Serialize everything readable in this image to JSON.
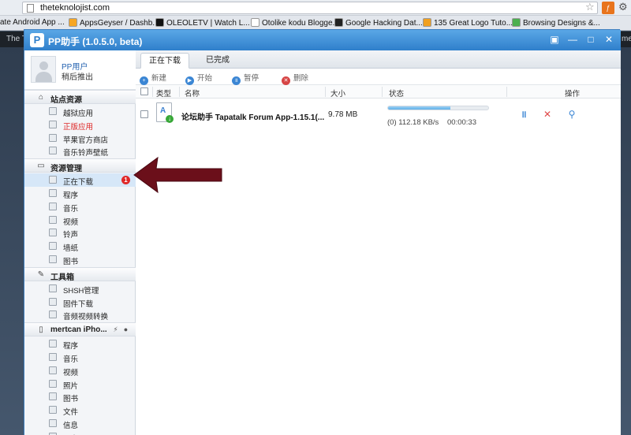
{
  "browser": {
    "url": "theteknolojist.com",
    "bookmarks": [
      {
        "label": "ate Android App ...",
        "color": "#8bc34a"
      },
      {
        "label": "AppsGeyser / Dashb...",
        "color": "#f6a623"
      },
      {
        "label": "OLEOLETV | Watch L...",
        "color": "#111111"
      },
      {
        "label": "Otolike kodu Blogge...",
        "color": "#ffffff"
      },
      {
        "label": "Google Hacking Dat...",
        "color": "#222222"
      },
      {
        "label": "135 Great Logo Tuto...",
        "color": "#f0a020"
      },
      {
        "label": "Browsing Designs &...",
        "color": "#4caf50"
      }
    ],
    "ext_label": "ƒ",
    "site_left": "The T",
    "site_right": "me"
  },
  "app": {
    "title": "PP助手 (1.0.5.0, beta)",
    "logo": "P",
    "window_buttons": [
      "▣",
      "—",
      "□",
      "✕"
    ],
    "user": {
      "name": "PP用户",
      "action": "稍后推出"
    },
    "groups": [
      {
        "label": "站点资源",
        "icon": "house-icon",
        "items": [
          {
            "label": "越狱应用",
            "icon": "jailbreak-icon",
            "state": "normal"
          },
          {
            "label": "正版应用",
            "icon": "store-icon",
            "state": "red"
          },
          {
            "label": "苹果官方商店",
            "icon": "apple-store-icon",
            "state": "normal"
          },
          {
            "label": "音乐铃声壁纸",
            "icon": "music-wallpaper-icon",
            "state": "normal"
          }
        ]
      },
      {
        "label": "资源管理",
        "icon": "monitor-icon",
        "items": [
          {
            "label": "正在下载",
            "icon": "download-icon",
            "state": "active",
            "badge": "1"
          },
          {
            "label": "程序",
            "icon": "program-icon",
            "state": "normal"
          },
          {
            "label": "音乐",
            "icon": "music-icon",
            "state": "normal"
          },
          {
            "label": "视频",
            "icon": "video-icon",
            "state": "normal"
          },
          {
            "label": "铃声",
            "icon": "ringtone-icon",
            "state": "normal"
          },
          {
            "label": "墙纸",
            "icon": "wallpaper-icon",
            "state": "normal"
          },
          {
            "label": "图书",
            "icon": "book-icon",
            "state": "normal"
          }
        ]
      },
      {
        "label": "工具箱",
        "icon": "toolbox-icon",
        "items": [
          {
            "label": "SHSH管理",
            "icon": "shsh-icon",
            "state": "normal"
          },
          {
            "label": "固件下载",
            "icon": "firmware-icon",
            "state": "normal"
          },
          {
            "label": "音频视频转换",
            "icon": "convert-icon",
            "state": "normal"
          }
        ]
      },
      {
        "label": "mertcan iPho...",
        "icon": "iphone-icon",
        "right_icons": [
          "charging-icon",
          "info-icon"
        ],
        "items": [
          {
            "label": "程序",
            "icon": "program-icon",
            "state": "normal"
          },
          {
            "label": "音乐",
            "icon": "music-icon",
            "state": "normal"
          },
          {
            "label": "视频",
            "icon": "video-icon",
            "state": "normal"
          },
          {
            "label": "照片",
            "icon": "photo-icon",
            "state": "normal"
          },
          {
            "label": "图书",
            "icon": "book-icon",
            "state": "normal"
          },
          {
            "label": "文件",
            "icon": "file-icon",
            "state": "normal"
          },
          {
            "label": "信息",
            "icon": "message-icon",
            "state": "normal"
          },
          {
            "label": "更多",
            "icon": "more-icon",
            "state": "normal"
          }
        ]
      }
    ],
    "tabs": [
      {
        "label": "正在下载",
        "active": true
      },
      {
        "label": "已完成",
        "active": false
      }
    ],
    "toolbar": {
      "new": "新建",
      "start": "开始",
      "pause": "暂停",
      "delete": "删除"
    },
    "columns": {
      "type": "类型",
      "name": "名称",
      "size": "大小",
      "status": "状态",
      "ops": "操作"
    },
    "downloads": [
      {
        "name": "论坛助手 Tapatalk Forum App-1.15.1(...",
        "size": "9.78 MB",
        "progress": 0.62,
        "speed": "(0) 112.18 KB/s",
        "time": "00:00:33"
      }
    ],
    "colors": {
      "accent": "#2f7fcb",
      "badge": "#e02828",
      "arrow": "#6b0f1a",
      "progress": "#5fb0e8"
    }
  }
}
